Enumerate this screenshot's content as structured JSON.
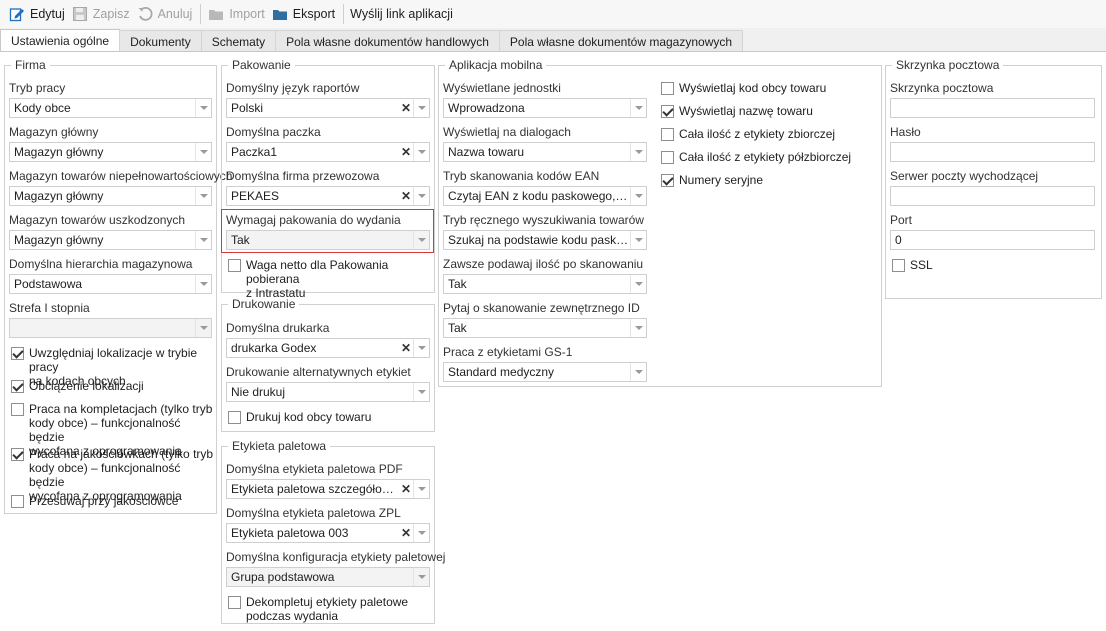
{
  "toolbar": {
    "edit": "Edytuj",
    "save": "Zapisz",
    "cancel": "Anuluj",
    "import": "Import",
    "export": "Eksport",
    "send_link": "Wyślij link aplikacji"
  },
  "tabs": [
    "Ustawienia ogólne",
    "Dokumenty",
    "Schematy",
    "Pola własne dokumentów handlowych",
    "Pola własne dokumentów magazynowych"
  ],
  "firma": {
    "title": "Firma",
    "tryb_pracy": {
      "label": "Tryb pracy",
      "value": "Kody obce"
    },
    "magazyn_glowny": {
      "label": "Magazyn główny",
      "value": "Magazyn główny"
    },
    "magazyn_niepelnowartosciowych": {
      "label": "Magazyn towarów niepełnowartościowych",
      "value": "Magazyn główny"
    },
    "magazyn_uszkodzonych": {
      "label": "Magazyn towarów uszkodzonych",
      "value": "Magazyn główny"
    },
    "hierarchia": {
      "label": "Domyślna hierarchia magazynowa",
      "value": "Podstawowa"
    },
    "strefa": {
      "label": "Strefa I stopnia",
      "value": ""
    },
    "checks": [
      {
        "lines": [
          "Uwzględniaj lokalizacje w trybie pracy",
          "na kodach obcych"
        ],
        "checked": true
      },
      {
        "lines": [
          "Obciążenie lokalizacji"
        ],
        "checked": true
      },
      {
        "lines": [
          "Praca na kompletacjach (tylko tryb",
          "kody obce) – funkcjonalność będzie",
          "wycofana z oprogramowania"
        ],
        "checked": false
      },
      {
        "lines": [
          "Praca na jakościówkach (tylko tryb",
          "kody obce) – funkcjonalność będzie",
          "wycofana z oprogramowania"
        ],
        "checked": true
      },
      {
        "lines": [
          "Przesuwaj przy jakościówce"
        ],
        "checked": false
      }
    ]
  },
  "pakowanie": {
    "title": "Pakowanie",
    "jezyk": {
      "label": "Domyślny język raportów",
      "value": "Polski"
    },
    "paczka": {
      "label": "Domyślna paczka",
      "value": "Paczka1"
    },
    "firma": {
      "label": "Domyślna firma przewozowa",
      "value": "PEKAES"
    },
    "wymagaj": {
      "label": "Wymagaj pakowania do wydania",
      "value": "Tak"
    },
    "waga": {
      "lines": [
        "Waga netto dla Pakowania pobierana",
        "z Intrastatu"
      ],
      "checked": false
    }
  },
  "drukowanie": {
    "title": "Drukowanie",
    "drukarka": {
      "label": "Domyślna drukarka",
      "value": "drukarka Godex"
    },
    "alternatywne": {
      "label": "Drukowanie alternatywnych etykiet",
      "value": "Nie drukuj"
    },
    "kod_obcy": {
      "lines": [
        "Drukuj kod obcy towaru"
      ],
      "checked": false
    }
  },
  "etykieta": {
    "title": "Etykieta paletowa",
    "pdf": {
      "label": "Domyślna etykieta paletowa PDF",
      "value": "Etykieta paletowa szczegółowa ..."
    },
    "zpl": {
      "label": "Domyślna etykieta paletowa ZPL",
      "value": "Etykieta paletowa 003"
    },
    "konfig": {
      "label": "Domyślna konfiguracja etykiety paletowej",
      "value": "Grupa podstawowa"
    },
    "dekompletuj": {
      "lines": [
        "Dekompletuj etykiety paletowe",
        "podczas wydania"
      ],
      "checked": false
    }
  },
  "aplikacja": {
    "title": "Aplikacja mobilna",
    "jednostki": {
      "label": "Wyświetlane jednostki",
      "value": "Wprowadzona"
    },
    "dialogi": {
      "label": "Wyświetlaj na dialogach",
      "value": "Nazwa towaru"
    },
    "ean": {
      "label": "Tryb skanowania kodów EAN",
      "value": "Czytaj EAN z kodu paskowego, kod..."
    },
    "reczny": {
      "label": "Tryb ręcznego wyszukiwania towarów",
      "value": "Szukaj na podstawie kodu paskowe..."
    },
    "ilosc": {
      "label": "Zawsze podawaj ilość po skanowaniu",
      "value": "Tak"
    },
    "pytaj": {
      "label": "Pytaj o skanowanie zewnętrznego ID",
      "value": "Tak"
    },
    "gs1": {
      "label": "Praca z etykietami GS-1",
      "value": "Standard medyczny"
    },
    "checks": [
      {
        "lines": [
          "Wyświetlaj kod obcy towaru"
        ],
        "checked": false
      },
      {
        "lines": [
          "Wyświetlaj nazwę towaru"
        ],
        "checked": true
      },
      {
        "lines": [
          "Cała ilość z etykiety zbiorczej"
        ],
        "checked": false
      },
      {
        "lines": [
          "Cała ilość z etykiety półzbiorczej"
        ],
        "checked": false
      },
      {
        "lines": [
          "Numery seryjne"
        ],
        "checked": true
      }
    ]
  },
  "skrzynka": {
    "title": "Skrzynka pocztowa",
    "skrzynka": {
      "label": "Skrzynka pocztowa",
      "value": ""
    },
    "haslo": {
      "label": "Hasło",
      "value": ""
    },
    "serwer": {
      "label": "Serwer poczty wychodzącej",
      "value": ""
    },
    "port": {
      "label": "Port",
      "value": "0"
    },
    "ssl": {
      "lines": [
        "SSL"
      ],
      "checked": false
    }
  },
  "colors": {
    "highlight": "#d9373b",
    "accent": "#1f6fbf"
  }
}
